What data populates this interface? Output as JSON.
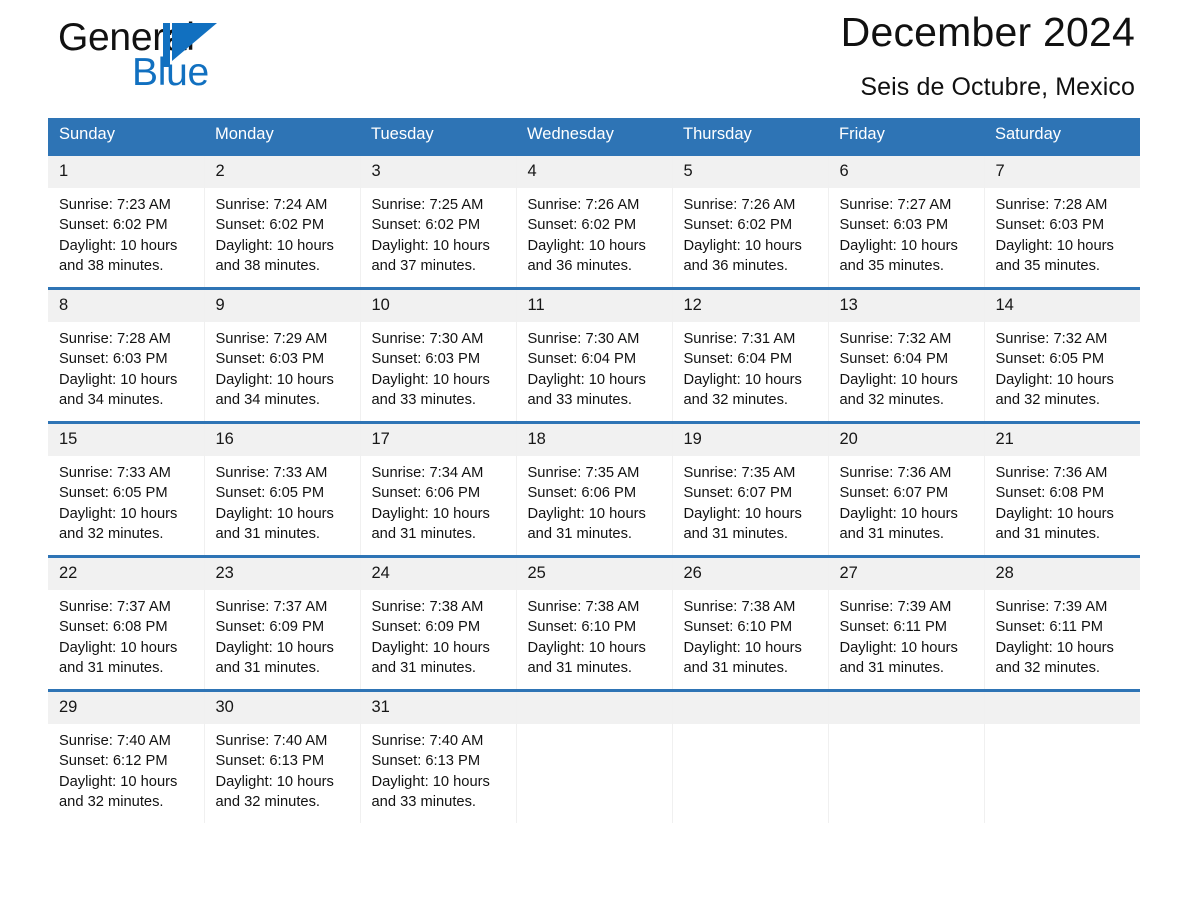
{
  "brand": {
    "name_dark": "General",
    "name_light": "Blue",
    "triangle_color": "#1170c0",
    "blue_color": "#1170c0"
  },
  "header": {
    "month_title": "December 2024",
    "location": "Seis de Octubre, Mexico"
  },
  "colors": {
    "header_blue": "#2e74b5",
    "daynum_band": "#f1f1f1",
    "text": "#121212"
  },
  "calendar": {
    "day_names": [
      "Sunday",
      "Monday",
      "Tuesday",
      "Wednesday",
      "Thursday",
      "Friday",
      "Saturday"
    ],
    "weeks": [
      [
        {
          "day": "1",
          "details": "Sunrise: 7:23 AM\nSunset: 6:02 PM\nDaylight: 10 hours\nand 38 minutes."
        },
        {
          "day": "2",
          "details": "Sunrise: 7:24 AM\nSunset: 6:02 PM\nDaylight: 10 hours\nand 38 minutes."
        },
        {
          "day": "3",
          "details": "Sunrise: 7:25 AM\nSunset: 6:02 PM\nDaylight: 10 hours\nand 37 minutes."
        },
        {
          "day": "4",
          "details": "Sunrise: 7:26 AM\nSunset: 6:02 PM\nDaylight: 10 hours\nand 36 minutes."
        },
        {
          "day": "5",
          "details": "Sunrise: 7:26 AM\nSunset: 6:02 PM\nDaylight: 10 hours\nand 36 minutes."
        },
        {
          "day": "6",
          "details": "Sunrise: 7:27 AM\nSunset: 6:03 PM\nDaylight: 10 hours\nand 35 minutes."
        },
        {
          "day": "7",
          "details": "Sunrise: 7:28 AM\nSunset: 6:03 PM\nDaylight: 10 hours\nand 35 minutes."
        }
      ],
      [
        {
          "day": "8",
          "details": "Sunrise: 7:28 AM\nSunset: 6:03 PM\nDaylight: 10 hours\nand 34 minutes."
        },
        {
          "day": "9",
          "details": "Sunrise: 7:29 AM\nSunset: 6:03 PM\nDaylight: 10 hours\nand 34 minutes."
        },
        {
          "day": "10",
          "details": "Sunrise: 7:30 AM\nSunset: 6:03 PM\nDaylight: 10 hours\nand 33 minutes."
        },
        {
          "day": "11",
          "details": "Sunrise: 7:30 AM\nSunset: 6:04 PM\nDaylight: 10 hours\nand 33 minutes."
        },
        {
          "day": "12",
          "details": "Sunrise: 7:31 AM\nSunset: 6:04 PM\nDaylight: 10 hours\nand 32 minutes."
        },
        {
          "day": "13",
          "details": "Sunrise: 7:32 AM\nSunset: 6:04 PM\nDaylight: 10 hours\nand 32 minutes."
        },
        {
          "day": "14",
          "details": "Sunrise: 7:32 AM\nSunset: 6:05 PM\nDaylight: 10 hours\nand 32 minutes."
        }
      ],
      [
        {
          "day": "15",
          "details": "Sunrise: 7:33 AM\nSunset: 6:05 PM\nDaylight: 10 hours\nand 32 minutes."
        },
        {
          "day": "16",
          "details": "Sunrise: 7:33 AM\nSunset: 6:05 PM\nDaylight: 10 hours\nand 31 minutes."
        },
        {
          "day": "17",
          "details": "Sunrise: 7:34 AM\nSunset: 6:06 PM\nDaylight: 10 hours\nand 31 minutes."
        },
        {
          "day": "18",
          "details": "Sunrise: 7:35 AM\nSunset: 6:06 PM\nDaylight: 10 hours\nand 31 minutes."
        },
        {
          "day": "19",
          "details": "Sunrise: 7:35 AM\nSunset: 6:07 PM\nDaylight: 10 hours\nand 31 minutes."
        },
        {
          "day": "20",
          "details": "Sunrise: 7:36 AM\nSunset: 6:07 PM\nDaylight: 10 hours\nand 31 minutes."
        },
        {
          "day": "21",
          "details": "Sunrise: 7:36 AM\nSunset: 6:08 PM\nDaylight: 10 hours\nand 31 minutes."
        }
      ],
      [
        {
          "day": "22",
          "details": "Sunrise: 7:37 AM\nSunset: 6:08 PM\nDaylight: 10 hours\nand 31 minutes."
        },
        {
          "day": "23",
          "details": "Sunrise: 7:37 AM\nSunset: 6:09 PM\nDaylight: 10 hours\nand 31 minutes."
        },
        {
          "day": "24",
          "details": "Sunrise: 7:38 AM\nSunset: 6:09 PM\nDaylight: 10 hours\nand 31 minutes."
        },
        {
          "day": "25",
          "details": "Sunrise: 7:38 AM\nSunset: 6:10 PM\nDaylight: 10 hours\nand 31 minutes."
        },
        {
          "day": "26",
          "details": "Sunrise: 7:38 AM\nSunset: 6:10 PM\nDaylight: 10 hours\nand 31 minutes."
        },
        {
          "day": "27",
          "details": "Sunrise: 7:39 AM\nSunset: 6:11 PM\nDaylight: 10 hours\nand 31 minutes."
        },
        {
          "day": "28",
          "details": "Sunrise: 7:39 AM\nSunset: 6:11 PM\nDaylight: 10 hours\nand 32 minutes."
        }
      ],
      [
        {
          "day": "29",
          "details": "Sunrise: 7:40 AM\nSunset: 6:12 PM\nDaylight: 10 hours\nand 32 minutes."
        },
        {
          "day": "30",
          "details": "Sunrise: 7:40 AM\nSunset: 6:13 PM\nDaylight: 10 hours\nand 32 minutes."
        },
        {
          "day": "31",
          "details": "Sunrise: 7:40 AM\nSunset: 6:13 PM\nDaylight: 10 hours\nand 33 minutes."
        },
        {
          "day": "",
          "details": ""
        },
        {
          "day": "",
          "details": ""
        },
        {
          "day": "",
          "details": ""
        },
        {
          "day": "",
          "details": ""
        }
      ]
    ]
  }
}
